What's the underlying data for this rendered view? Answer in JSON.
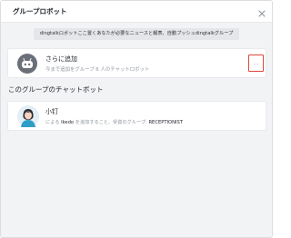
{
  "dialog": {
    "title": "グループロボット",
    "close_icon": "close-icon"
  },
  "banner": {
    "text": "dingtalkロボットここ置くあなたが必要なニュースと報表、自動プッシュdingtalkグループ"
  },
  "add_card": {
    "icon": "robot-icon",
    "title": "さらに追加",
    "subtitle": "今まで追加をグループ 6 人のチャットロボット",
    "more_label": "...",
    "highlight_color": "#e0463c"
  },
  "section": {
    "heading": "このグループのチャットボット"
  },
  "bots": [
    {
      "avatar": "person-avatar-icon",
      "name": "小钉",
      "desc_prefix": "による",
      "desc_user": "Ikedo",
      "desc_middle": "を追加すること、受賞のグループ:",
      "desc_group": "RECEPTIONIST"
    }
  ]
}
